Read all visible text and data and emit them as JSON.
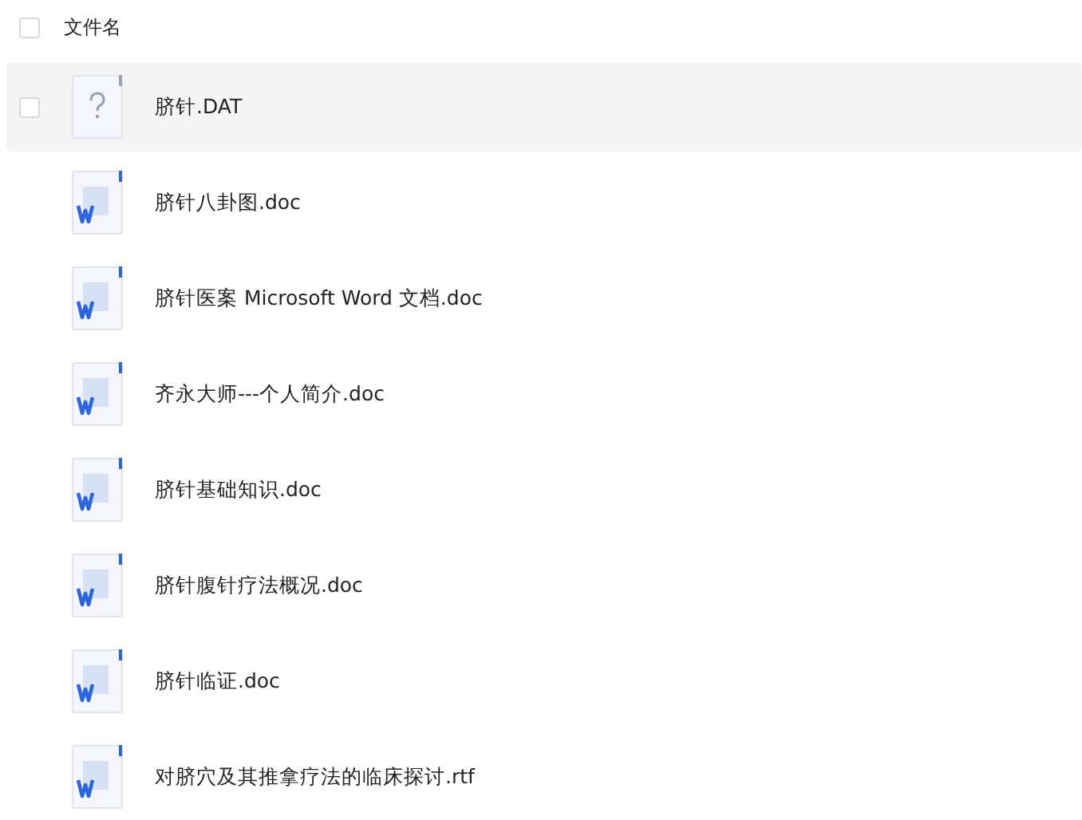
{
  "header": {
    "checked": false,
    "label": "文件名"
  },
  "files": [
    {
      "name": "脐针.DAT",
      "kind": "unknown",
      "hovered": true,
      "checked": false
    },
    {
      "name": "脐针八卦图.doc",
      "kind": "word",
      "hovered": false
    },
    {
      "name": "脐针医案 Microsoft Word 文档.doc",
      "kind": "word",
      "hovered": false
    },
    {
      "name": "齐永大师---个人简介.doc",
      "kind": "word",
      "hovered": false
    },
    {
      "name": "脐针基础知识.doc",
      "kind": "word",
      "hovered": false
    },
    {
      "name": "脐针腹针疗法概况.doc",
      "kind": "word",
      "hovered": false
    },
    {
      "name": "脐针临证.doc",
      "kind": "word",
      "hovered": false
    },
    {
      "name": "对脐穴及其推拿疗法的临床探讨.rtf",
      "kind": "word",
      "hovered": false
    }
  ]
}
